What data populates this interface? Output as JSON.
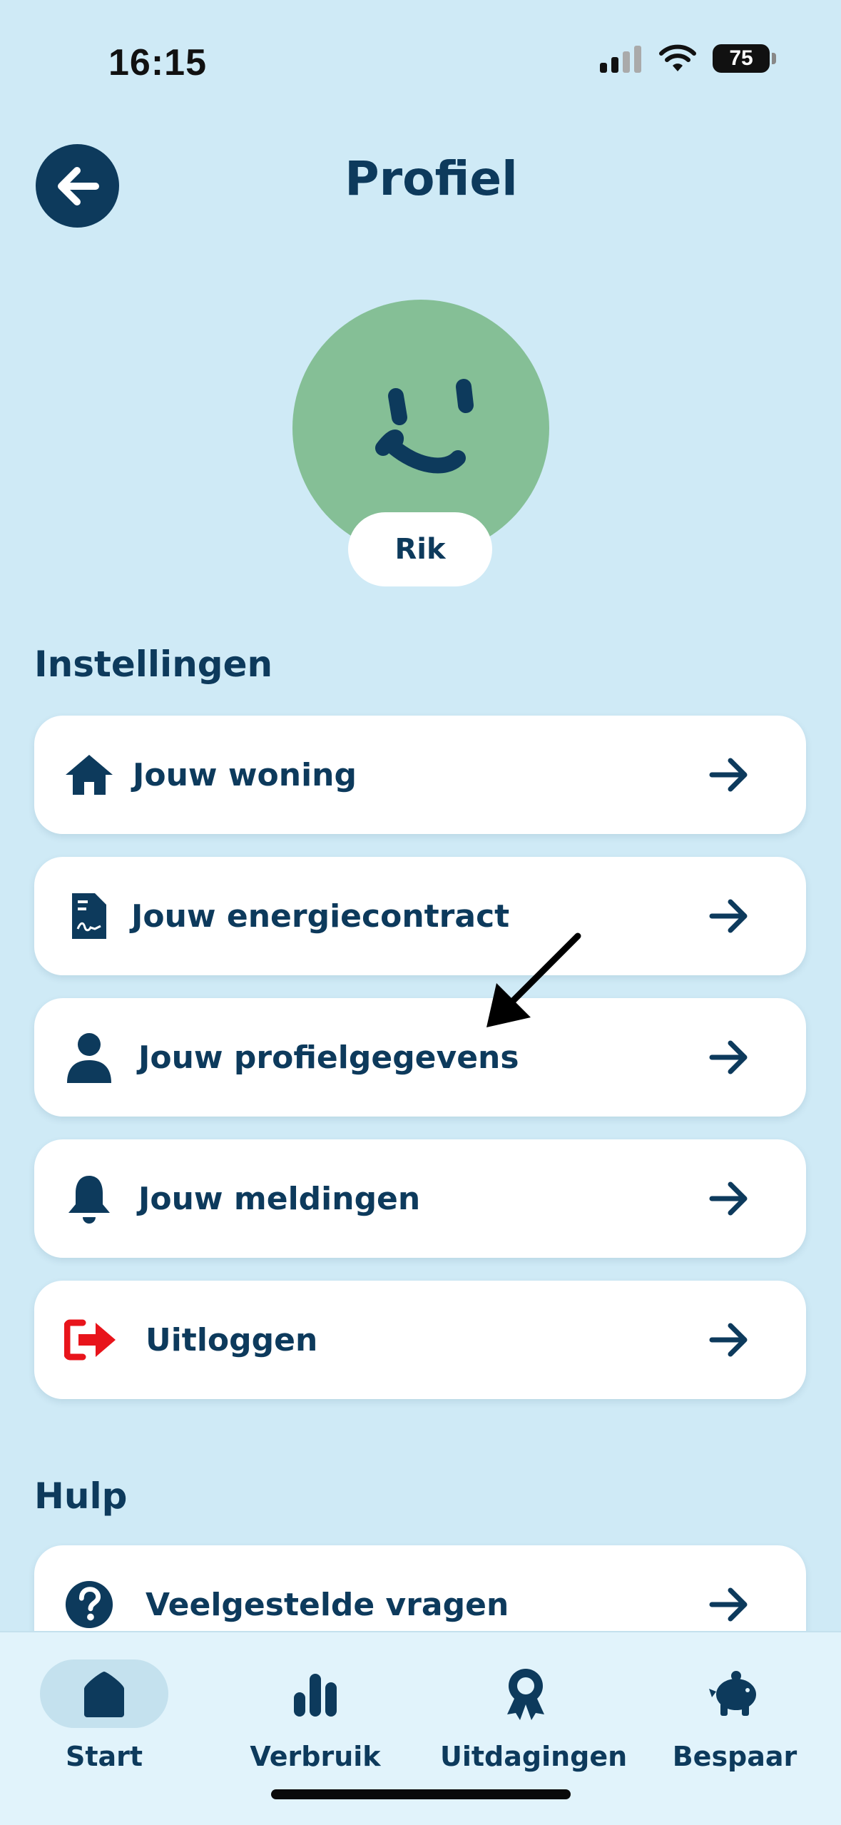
{
  "status_bar": {
    "time": "16:15",
    "battery": "75"
  },
  "header": {
    "title": "Profiel",
    "back_icon": "arrow-left-icon"
  },
  "profile": {
    "name": "Rik",
    "avatar_color": "#85bf96"
  },
  "settings": {
    "title": "Instellingen",
    "items": [
      {
        "label": "Jouw woning",
        "icon": "house-icon"
      },
      {
        "label": "Jouw energiecontract",
        "icon": "document-icon"
      },
      {
        "label": "Jouw profielgegevens",
        "icon": "person-icon"
      },
      {
        "label": "Jouw meldingen",
        "icon": "bell-icon"
      },
      {
        "label": "Uitloggen",
        "icon": "logout-icon",
        "color": "#e8141b"
      }
    ]
  },
  "help": {
    "title": "Hulp",
    "items": [
      {
        "label": "Veelgestelde vragen",
        "icon": "question-icon"
      }
    ]
  },
  "bottom_nav": {
    "items": [
      {
        "label": "Start",
        "icon": "home-icon",
        "active": true
      },
      {
        "label": "Verbruik",
        "icon": "bar-chart-icon"
      },
      {
        "label": "Uitdagingen",
        "icon": "award-icon"
      },
      {
        "label": "Bespaar",
        "icon": "piggy-bank-icon"
      }
    ]
  },
  "colors": {
    "background": "#cfeaf6",
    "primary": "#0d3a5c",
    "card": "#ffffff",
    "logout": "#e8141b"
  }
}
